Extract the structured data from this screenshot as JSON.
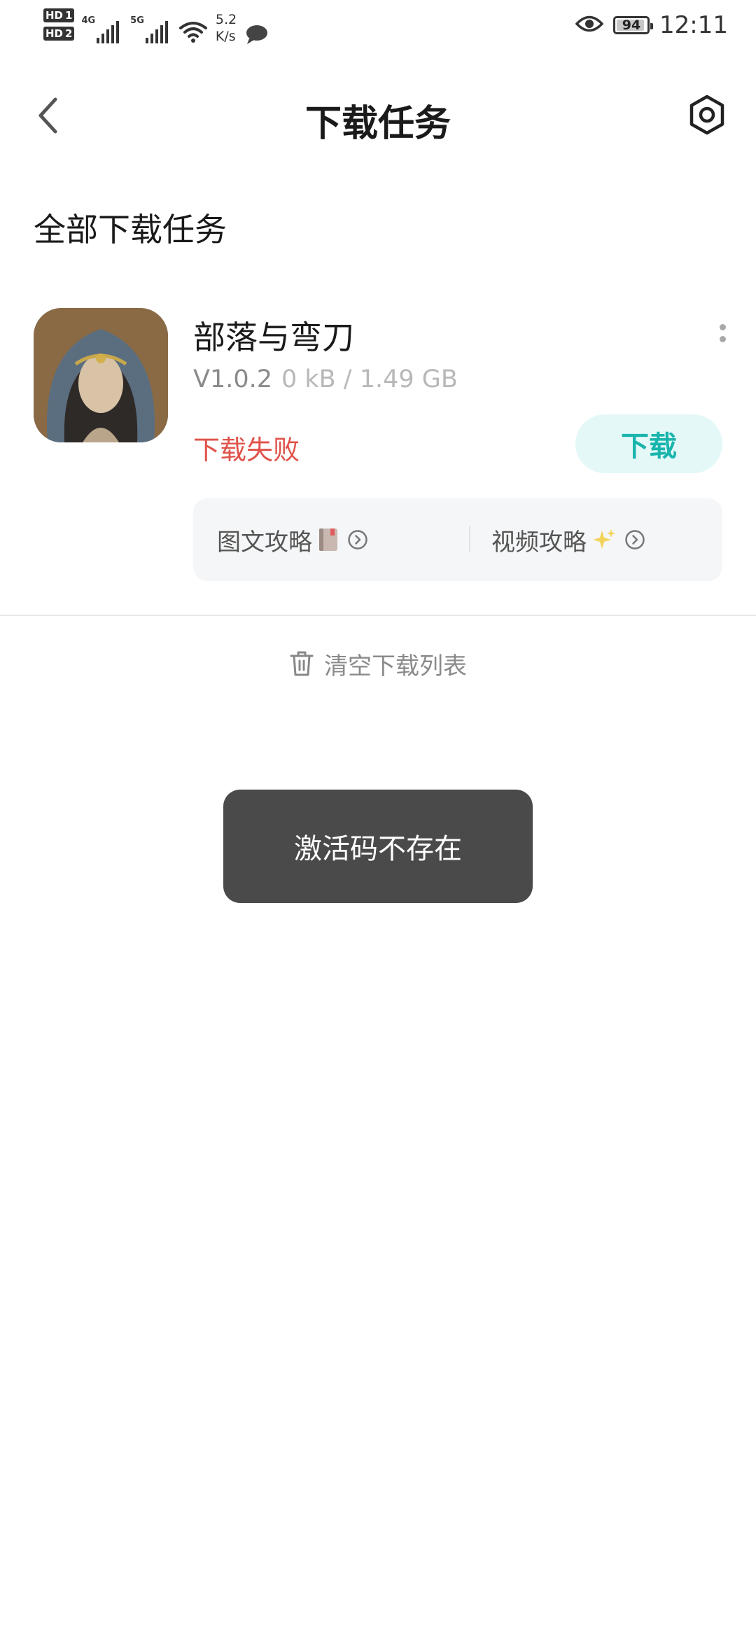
{
  "status_bar": {
    "hd1": "HD",
    "hd1_num": "1",
    "hd2": "HD",
    "hd2_num": "2",
    "net1": "4G",
    "net2": "5G",
    "speed_value": "5.2",
    "speed_unit": "K/s",
    "battery_level": "94",
    "battery_fraction": 0.94,
    "time": "12:11",
    "icons": [
      "signal-icon",
      "wifi-icon",
      "message-icon",
      "eye-icon",
      "battery-icon"
    ]
  },
  "header": {
    "title": "下载任务",
    "back_icon": "chevron-left-icon",
    "settings_icon": "hexagon-settings-icon"
  },
  "section": {
    "title": "全部下载任务"
  },
  "task": {
    "name": "部落与弯刀",
    "version": "V1.0.2",
    "size": "0 kB / 1.49 GB",
    "status": "下载失败",
    "download_label": "下载",
    "guides": [
      {
        "label": "图文攻略",
        "emoji": "📕"
      },
      {
        "label": "视频攻略",
        "emoji": "✨"
      }
    ]
  },
  "clear_list": {
    "label": "清空下载列表"
  },
  "toast": {
    "message": "激活码不存在"
  },
  "colors": {
    "accent": "#19b5ad",
    "accent_bg": "#e4f8f8",
    "error": "#e0524a",
    "toast_bg": "#4a4a4a"
  }
}
